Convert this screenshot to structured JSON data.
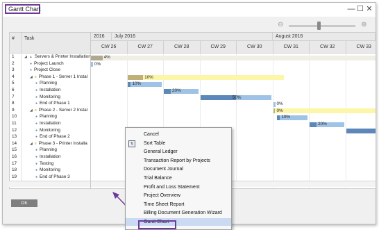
{
  "window": {
    "title": "Gantt Chart",
    "minimize_glyph": "—",
    "maximize_glyph": "☐",
    "close_glyph": "✕"
  },
  "zoom": {
    "zoom_out_icon": "zoom-out-icon",
    "zoom_in_icon": "zoom-in-icon",
    "level": 0.45
  },
  "grid": {
    "headers": {
      "num": "#",
      "task": "Task"
    },
    "years": [
      {
        "label": "2016"
      },
      {
        "label": "July 2016"
      },
      {
        "label": "August 2016"
      }
    ],
    "weeks": [
      "CW 26",
      "CW 27",
      "CW 28",
      "CW 29",
      "CW 30",
      "CW 31",
      "CW 32",
      "CW 33"
    ],
    "rows": [
      {
        "num": "1",
        "task": "Servers & Printer Installation",
        "level": 0,
        "kind": "group-root"
      },
      {
        "num": "2",
        "task": "Project Launch",
        "level": 1,
        "kind": "milestone"
      },
      {
        "num": "3",
        "task": "Project Close",
        "level": 1,
        "kind": "milestone"
      },
      {
        "num": "4",
        "task": "Phase 1 - Server 1 Instal",
        "level": 1,
        "kind": "phase"
      },
      {
        "num": "5",
        "task": "Planning",
        "level": 2,
        "kind": "task"
      },
      {
        "num": "6",
        "task": "Installation",
        "level": 2,
        "kind": "task"
      },
      {
        "num": "7",
        "task": "Monitoring",
        "level": 2,
        "kind": "task"
      },
      {
        "num": "8",
        "task": "End of Phase 1",
        "level": 2,
        "kind": "task"
      },
      {
        "num": "9",
        "task": "Phase 2 - Server 2 Instal",
        "level": 1,
        "kind": "phase"
      },
      {
        "num": "10",
        "task": "Planning",
        "level": 2,
        "kind": "task"
      },
      {
        "num": "11",
        "task": "Installation",
        "level": 2,
        "kind": "task"
      },
      {
        "num": "12",
        "task": "Monitoring",
        "level": 2,
        "kind": "task"
      },
      {
        "num": "13",
        "task": "End of Phase 2",
        "level": 2,
        "kind": "task"
      },
      {
        "num": "14",
        "task": "Phase 3 - Printer Installa",
        "level": 1,
        "kind": "phase"
      },
      {
        "num": "15",
        "task": "Planning",
        "level": 2,
        "kind": "task"
      },
      {
        "num": "16",
        "task": "Installation",
        "level": 2,
        "kind": "task"
      },
      {
        "num": "17",
        "task": "Testing",
        "level": 2,
        "kind": "task"
      },
      {
        "num": "18",
        "task": "Monitoring",
        "level": 2,
        "kind": "task"
      },
      {
        "num": "19",
        "task": "End of Phase 3",
        "level": 2,
        "kind": "task"
      }
    ],
    "bars": [
      {
        "row": 0,
        "start": 0.0,
        "end": 7.9,
        "progress": 0.04,
        "label": "4%",
        "color": "#b0a98f",
        "fill": "#f0efe6"
      },
      {
        "row": 1,
        "start": 0.0,
        "end": 0.0,
        "progress": 0,
        "label": "0%",
        "color": "#9fc3e6",
        "fill": "#9fc3e6"
      },
      {
        "row": 3,
        "start": 1.0,
        "end": 5.3,
        "progress": 0.1,
        "label": "10%",
        "color": "#c0b078",
        "fill": "#fcf6a8"
      },
      {
        "row": 4,
        "start": 1.0,
        "end": 1.95,
        "progress": 0.1,
        "label": "10%",
        "color": "#5d87b8",
        "fill": "#9fc3e6"
      },
      {
        "row": 5,
        "start": 2.0,
        "end": 2.95,
        "progress": 0.2,
        "label": "20%",
        "color": "#5d87b8",
        "fill": "#9fc3e6"
      },
      {
        "row": 6,
        "start": 3.0,
        "end": 4.95,
        "progress": 0.5,
        "label": "50%",
        "color": "#5d87b8",
        "fill": "#9fc3e6"
      },
      {
        "row": 7,
        "start": 5.0,
        "end": 5.0,
        "progress": 0,
        "label": "0%",
        "color": "#9fc3e6",
        "fill": "#9fc3e6"
      },
      {
        "row": 8,
        "start": 5.0,
        "end": 8.0,
        "progress": 0,
        "label": "0%",
        "color": "#c0b078",
        "fill": "#fcf6a8"
      },
      {
        "row": 9,
        "start": 5.1,
        "end": 5.95,
        "progress": 0.1,
        "label": "10%",
        "color": "#5d87b8",
        "fill": "#9fc3e6"
      },
      {
        "row": 10,
        "start": 6.0,
        "end": 6.95,
        "progress": 0.2,
        "label": "20%",
        "color": "#5d87b8",
        "fill": "#9fc3e6"
      },
      {
        "row": 11,
        "start": 7.0,
        "end": 8.0,
        "progress": 1.0,
        "label": "",
        "color": "#5d87b8",
        "fill": "#9fc3e6"
      }
    ]
  },
  "footer": {
    "ok_label": "OK"
  },
  "context_menu": {
    "items": [
      {
        "label": "Cancel",
        "icon": ""
      },
      {
        "label": "Sort Table",
        "icon": "sort-table-icon"
      },
      {
        "label": "General Ledger",
        "icon": ""
      },
      {
        "label": "Transaction Report by Projects",
        "icon": ""
      },
      {
        "label": "Document Journal",
        "icon": ""
      },
      {
        "label": "Trial Balance",
        "icon": ""
      },
      {
        "label": "Profit and Loss Statement",
        "icon": ""
      },
      {
        "label": "Project Overview",
        "icon": ""
      },
      {
        "label": "Time Sheet Report",
        "icon": ""
      },
      {
        "label": "Billing Document Generation Wizard",
        "icon": ""
      },
      {
        "label": "Gantt Chart",
        "icon": "",
        "selected": true
      }
    ]
  },
  "colors": {
    "highlight_frame": "#6d3a9c",
    "menu_selected": "#c9daf2"
  }
}
